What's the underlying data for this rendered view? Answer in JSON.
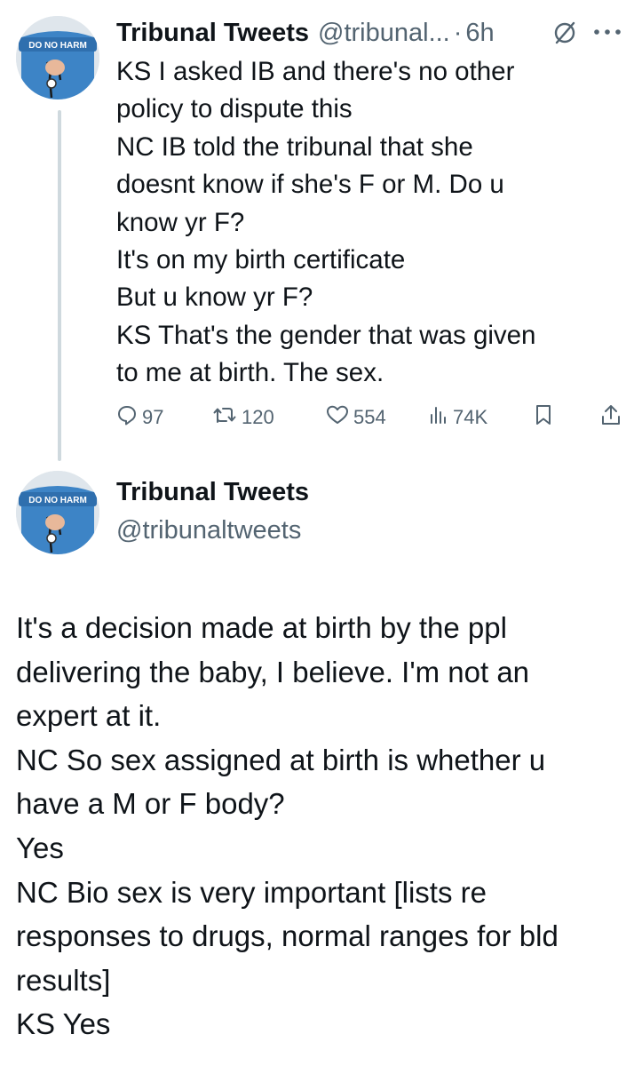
{
  "tweet1": {
    "author_name": "Tribunal Tweets",
    "author_handle": "@tribunal...",
    "separator": "·",
    "time": "6h",
    "avatar_text": "DO NO HARM",
    "lines": [
      "KS  I asked IB and there's no other",
      "policy to dispute this",
      "NC  IB told the tribunal that she",
      "doesnt know if she's F or M. Do u",
      "know yr F?",
      "It's on my birth certificate",
      "But u know yr F?",
      "KS That's the gender that was given",
      "to me at birth. The sex."
    ],
    "actions": {
      "replies": "97",
      "reposts": "120",
      "likes": "554",
      "views": "74K"
    }
  },
  "tweet2": {
    "author_name": "Tribunal Tweets",
    "author_handle": "@tribunaltweets",
    "avatar_text": "DO NO HARM",
    "lines": [
      "It's a decision made at birth by the ppl",
      "delivering the baby, I believe. I'm not an",
      "expert at it.",
      "NC  So sex assigned at birth is whether u",
      "have a M or F body?",
      "Yes",
      "NC  Bio sex is very important [lists re",
      "responses to drugs, normal ranges for bld",
      "results]",
      "KS  Yes"
    ]
  },
  "icons": {
    "reply": "reply-icon",
    "repost": "repost-icon",
    "like": "heart-icon",
    "views": "views-icon",
    "bookmark": "bookmark-icon",
    "share": "share-icon",
    "grok": "grok-icon",
    "more": "more-icon"
  },
  "colors": {
    "text": "#0f1419",
    "secondary": "#536471",
    "thread_line": "#cfd9de",
    "avatar_shirt": "#3d84c6"
  }
}
